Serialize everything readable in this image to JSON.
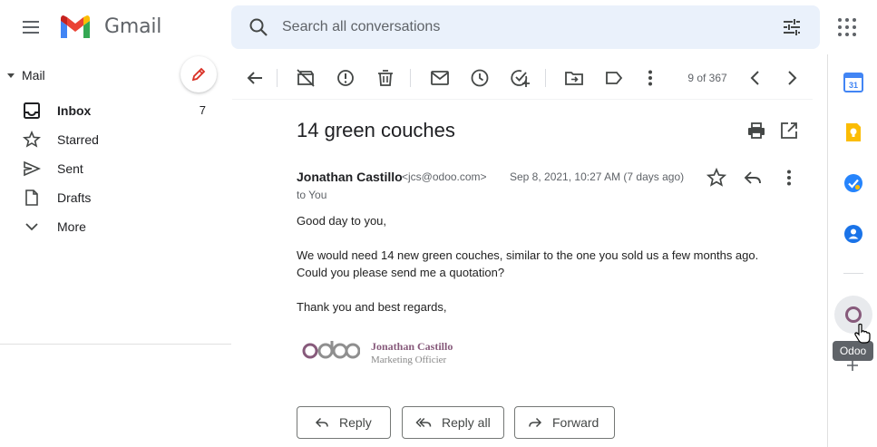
{
  "app": {
    "brand": "Gmail"
  },
  "search": {
    "placeholder": "Search all conversations"
  },
  "sidebar": {
    "section_label": "Mail",
    "items": [
      {
        "label": "Inbox",
        "count": "7"
      },
      {
        "label": "Starred",
        "count": ""
      },
      {
        "label": "Sent",
        "count": ""
      },
      {
        "label": "Drafts",
        "count": ""
      },
      {
        "label": "More",
        "count": ""
      }
    ]
  },
  "toolbar": {
    "pager": "9 of 367"
  },
  "message": {
    "subject": "14 green couches",
    "sender_name": "Jonathan Castillo",
    "sender_email": "<jcs@odoo.com>",
    "date": "Sep 8, 2021, 10:27 AM (7 days ago)",
    "to": "to You",
    "body": [
      "Good day to you,",
      "We would need 14 new green couches, similar to the one you sold us a few months ago.",
      "Could you please send me a quotation?",
      "Thank you and best regards,"
    ],
    "signature": {
      "name": "Jonathan Castillo",
      "title": "Marketing Officier",
      "logo_text": "odoo"
    }
  },
  "actions": {
    "reply": "Reply",
    "reply_all": "Reply all",
    "forward": "Forward"
  },
  "side_panel": {
    "tooltip": "Odoo"
  },
  "colors": {
    "search_bg": "#eaf1fb",
    "odoo_purple": "#875a7b",
    "compose_pencil": "#d93025"
  },
  "icons": [
    "menu-icon",
    "gmail-logo",
    "search-icon",
    "tune-icon",
    "apps-icon",
    "pencil-icon",
    "inbox-icon",
    "star-icon",
    "send-icon",
    "draft-icon",
    "chevron-down-icon",
    "back-icon",
    "archive-icon",
    "report-spam-icon",
    "delete-icon",
    "mark-unread-icon",
    "snooze-icon",
    "add-task-icon",
    "move-to-icon",
    "label-icon",
    "more-vert-icon",
    "prev-icon",
    "next-icon",
    "print-icon",
    "open-new-window-icon",
    "reply-icon",
    "calendar-icon",
    "keep-icon",
    "tasks-icon",
    "contacts-icon",
    "odoo-icon",
    "plus-icon"
  ]
}
